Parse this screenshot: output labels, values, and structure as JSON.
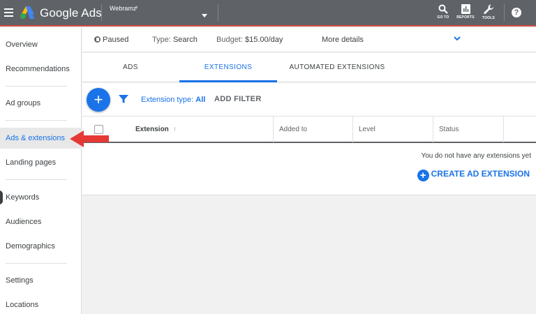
{
  "header": {
    "brand": "Google Ads",
    "account": "Webramz",
    "account_caret": "›",
    "tools": [
      {
        "label": "GO TO",
        "icon": "search-icon"
      },
      {
        "label": "REPORTS",
        "icon": "reports-icon"
      },
      {
        "label": "TOOLS",
        "icon": "wrench-icon"
      }
    ],
    "help": "?"
  },
  "sidebar": {
    "items": [
      {
        "label": "Overview"
      },
      {
        "label": "Recommendations"
      },
      {
        "label": "Ad groups"
      },
      {
        "label": "Ads & extensions",
        "active": true
      },
      {
        "label": "Landing pages"
      },
      {
        "label": "Keywords"
      },
      {
        "label": "Audiences"
      },
      {
        "label": "Demographics"
      },
      {
        "label": "Settings"
      },
      {
        "label": "Locations"
      }
    ]
  },
  "status": {
    "state": "Paused",
    "type_label": "Type:",
    "type_value": "Search",
    "budget_label": "Budget:",
    "budget_value": "$15.00/day",
    "more_details": "More details"
  },
  "tabs": [
    {
      "label": "ADS"
    },
    {
      "label": "EXTENSIONS",
      "active": true
    },
    {
      "label": "AUTOMATED EXTENSIONS"
    }
  ],
  "filter": {
    "add_button": "+",
    "type_label": "Extension type:",
    "type_value": "All",
    "add_filter": "ADD FILTER"
  },
  "table": {
    "columns": [
      "Extension",
      "Added to",
      "Level",
      "Status"
    ],
    "sort_indicator": "↑",
    "empty_message": "You do not have any extensions yet",
    "create_label": "CREATE AD EXTENSION",
    "create_icon": "+"
  },
  "colors": {
    "accent": "#1a73e8",
    "topbar": "#5f6368",
    "annotation": "#e53935"
  }
}
